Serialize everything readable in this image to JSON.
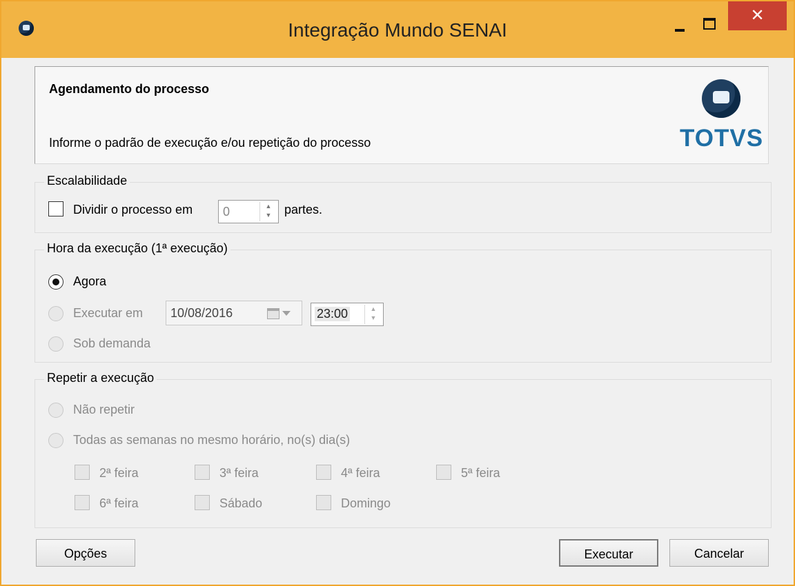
{
  "window": {
    "title": "Integração Mundo SENAI",
    "close_glyph": "✕",
    "icons": {
      "app": "app-icon",
      "minimize": "minimize-icon",
      "maximize": "maximize-icon",
      "close": "close-icon"
    }
  },
  "header": {
    "title": "Agendamento do processo",
    "subtitle": "Informe o padrão de execução e/ou repetição do processo",
    "logo_text": "TOTVS",
    "logo_color": "#1f6fa5"
  },
  "escalabilidade": {
    "label": "Escalabilidade",
    "checkbox_label": "Dividir o processo em",
    "parts_value": "0",
    "suffix": "partes."
  },
  "hora": {
    "label": "Hora da execução (1ª execução)",
    "agora": "Agora",
    "executar_em": "Executar em",
    "date_value": "10/08/2016",
    "time_value": "23:00",
    "sob_demanda": "Sob demanda",
    "selected": "Agora"
  },
  "repetir": {
    "label": "Repetir a execução",
    "nao_repetir": "Não repetir",
    "todas_semanas": "Todas as semanas no mesmo horário, no(s) dia(s)",
    "days": [
      "2ª feira",
      "3ª feira",
      "4ª feira",
      "5ª feira",
      "6ª feira",
      "Sábado",
      "Domingo"
    ]
  },
  "buttons": {
    "opcoes": "Opções",
    "executar": "Executar",
    "cancelar": "Cancelar"
  },
  "colors": {
    "titlebar": "#f2b444",
    "close": "#c84031"
  }
}
